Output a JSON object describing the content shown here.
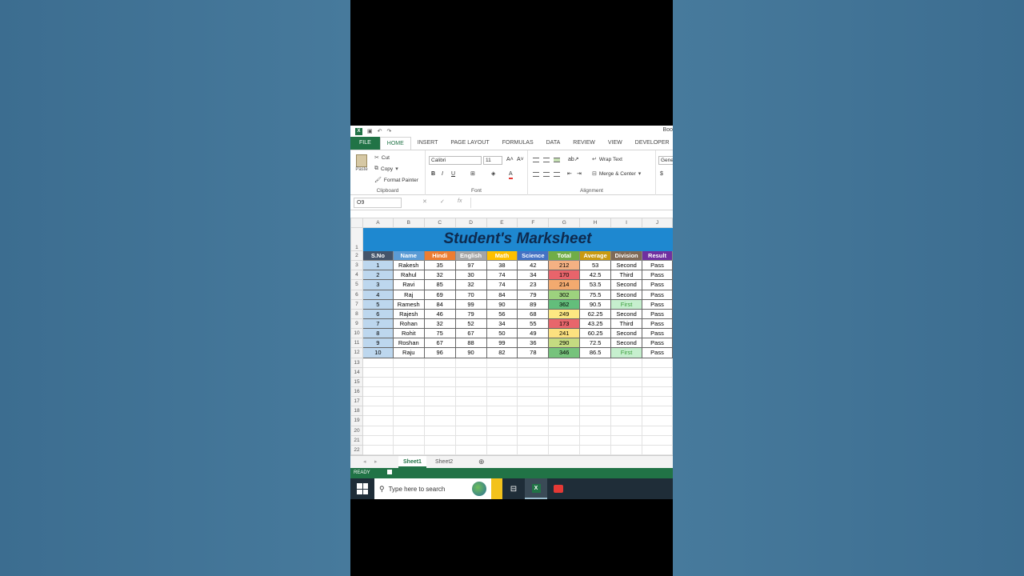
{
  "app": {
    "title": "Boo",
    "qat": {
      "undo": "↶",
      "redo": "↷"
    }
  },
  "tabs": [
    "FILE",
    "HOME",
    "INSERT",
    "PAGE LAYOUT",
    "FORMULAS",
    "DATA",
    "REVIEW",
    "VIEW",
    "DEVELOPER"
  ],
  "ribbon": {
    "clipboard": {
      "paste": "Paste",
      "cut": "Cut",
      "copy": "Copy",
      "format_painter": "Format Painter",
      "label": "Clipboard"
    },
    "font": {
      "name": "Calibri",
      "size": "11",
      "bold": "B",
      "italic": "I",
      "underline": "U",
      "label": "Font"
    },
    "alignment": {
      "wrap_text": "Wrap Text",
      "merge_center": "Merge & Center",
      "label": "Alignment"
    },
    "number": {
      "format": "Gene",
      "currency": "$"
    }
  },
  "formula_bar": {
    "name_box": "O9",
    "cancel": "✕",
    "enter": "✓",
    "fx": "fx",
    "value": ""
  },
  "columns": [
    "A",
    "B",
    "C",
    "D",
    "E",
    "F",
    "G",
    "H",
    "I",
    "J"
  ],
  "sheet_title": "Student's Marksheet",
  "headers": [
    {
      "label": "S.No",
      "color": "#44546a"
    },
    {
      "label": "Name",
      "color": "#5b9bd5"
    },
    {
      "label": "Hindi",
      "color": "#ed7d31"
    },
    {
      "label": "English",
      "color": "#a5a5a5"
    },
    {
      "label": "Math",
      "color": "#ffc000"
    },
    {
      "label": "Science",
      "color": "#4472c4"
    },
    {
      "label": "Total",
      "color": "#70ad47"
    },
    {
      "label": "Average",
      "color": "#c99a12"
    },
    {
      "label": "Division",
      "color": "#7f6a57"
    },
    {
      "label": "Result",
      "color": "#7030a0"
    }
  ],
  "rows": [
    {
      "sno": "1",
      "name": "Rakesh",
      "hindi": "35",
      "english": "97",
      "math": "38",
      "science": "42",
      "total": "212",
      "total_color": "#f4b183",
      "average": "53",
      "division": "Second",
      "result": "Pass"
    },
    {
      "sno": "2",
      "name": "Rahul",
      "hindi": "32",
      "english": "30",
      "math": "74",
      "science": "34",
      "total": "170",
      "total_color": "#e8646b",
      "average": "42.5",
      "division": "Third",
      "result": "Pass"
    },
    {
      "sno": "3",
      "name": "Ravi",
      "hindi": "85",
      "english": "32",
      "math": "74",
      "science": "23",
      "total": "214",
      "total_color": "#f3aa6f",
      "average": "53.5",
      "division": "Second",
      "result": "Pass"
    },
    {
      "sno": "4",
      "name": "Raj",
      "hindi": "69",
      "english": "70",
      "math": "84",
      "science": "79",
      "total": "302",
      "total_color": "#9dd27e",
      "average": "75.5",
      "division": "Second",
      "result": "Pass"
    },
    {
      "sno": "5",
      "name": "Ramesh",
      "hindi": "84",
      "english": "99",
      "math": "90",
      "science": "89",
      "total": "362",
      "total_color": "#63be7b",
      "average": "90.5",
      "division": "First",
      "result": "Pass"
    },
    {
      "sno": "6",
      "name": "Rajesh",
      "hindi": "46",
      "english": "79",
      "math": "56",
      "science": "68",
      "total": "249",
      "total_color": "#fde882",
      "average": "62.25",
      "division": "Second",
      "result": "Pass"
    },
    {
      "sno": "7",
      "name": "Rohan",
      "hindi": "32",
      "english": "52",
      "math": "34",
      "science": "55",
      "total": "173",
      "total_color": "#e8666b",
      "average": "43.25",
      "division": "Third",
      "result": "Pass"
    },
    {
      "sno": "8",
      "name": "Rohit",
      "hindi": "75",
      "english": "67",
      "math": "50",
      "science": "49",
      "total": "241",
      "total_color": "#fde17f",
      "average": "60.25",
      "division": "Second",
      "result": "Pass"
    },
    {
      "sno": "9",
      "name": "Roshan",
      "hindi": "67",
      "english": "88",
      "math": "99",
      "science": "36",
      "total": "290",
      "total_color": "#c5db81",
      "average": "72.5",
      "division": "Second",
      "result": "Pass"
    },
    {
      "sno": "10",
      "name": "Raju",
      "hindi": "96",
      "english": "90",
      "math": "82",
      "science": "78",
      "total": "346",
      "total_color": "#76c37c",
      "average": "86.5",
      "division": "First",
      "result": "Pass"
    }
  ],
  "first_division": {
    "text_color": "#3e9f3e",
    "fill": "#c6efce"
  },
  "empty_rows": [
    "13",
    "14",
    "15",
    "16",
    "17",
    "18",
    "19",
    "20",
    "21",
    "22"
  ],
  "sheet_tabs": [
    "Sheet1",
    "Sheet2"
  ],
  "status": "READY",
  "taskbar": {
    "search_placeholder": "Type here to search"
  }
}
